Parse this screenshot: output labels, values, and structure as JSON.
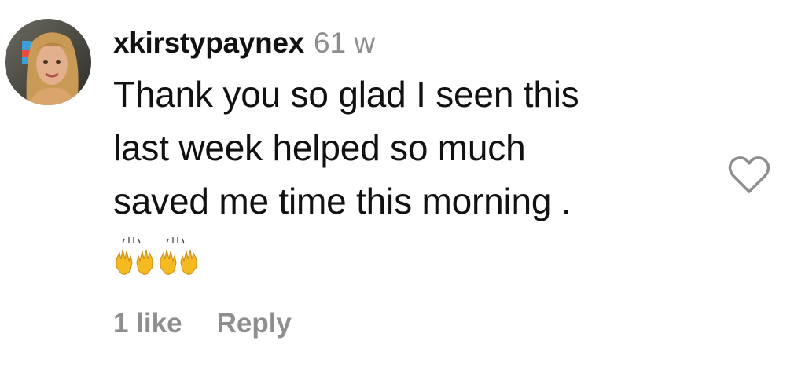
{
  "comment": {
    "username": "xkirstypaynex",
    "timestamp": "61 w",
    "text_lines": [
      "Thank you so glad I seen this",
      "last week helped so much",
      "saved me time this morning ."
    ],
    "emoji": "raising-hands-emoji x2",
    "likes_label": "1 like",
    "reply_label": "Reply"
  },
  "icons": {
    "like": "heart-outline-icon",
    "avatar": "user-avatar"
  },
  "colors": {
    "text": "#111111",
    "muted": "#8e8e8e",
    "heart_stroke": "#8e8e8e",
    "emoji": "#f5b921"
  }
}
